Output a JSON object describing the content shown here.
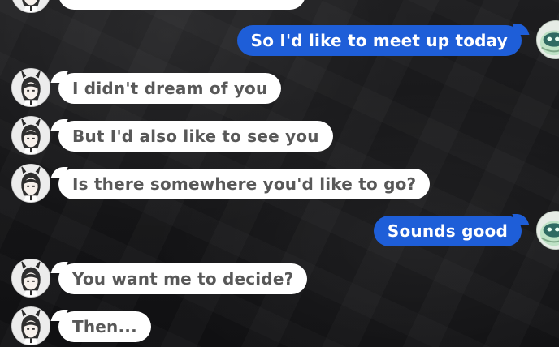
{
  "conversation": {
    "messages": [
      {
        "sender": "other",
        "text": ""
      },
      {
        "sender": "me",
        "text": "So I'd like to meet up today"
      },
      {
        "sender": "other",
        "text": "I didn't dream of you"
      },
      {
        "sender": "other",
        "text": "But I'd also like to see you"
      },
      {
        "sender": "other",
        "text": "Is there somewhere you'd like to go?"
      },
      {
        "sender": "me",
        "text": "Sounds good"
      },
      {
        "sender": "other",
        "text": "You want me to decide?"
      },
      {
        "sender": "other",
        "text": "Then..."
      }
    ]
  },
  "colors": {
    "outgoing_bubble": "#1e5ed8",
    "incoming_bubble": "#ffffff",
    "incoming_text": "#585858",
    "background": "#141416"
  },
  "icons": {
    "other_avatar": "bunny-girl-avatar-icon",
    "me_avatar": "green-round-robot-avatar-icon"
  }
}
